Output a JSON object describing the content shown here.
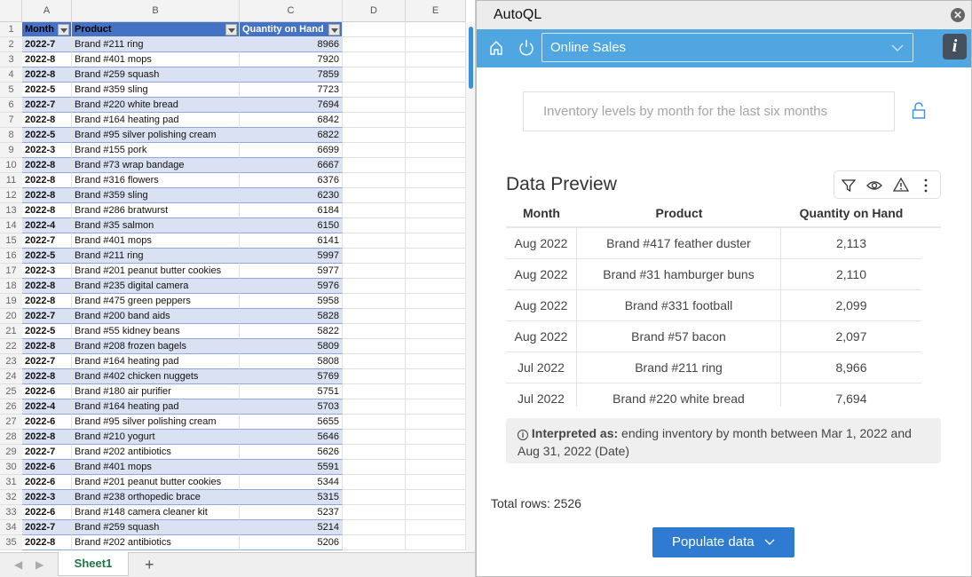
{
  "spreadsheet": {
    "column_letters": [
      "A",
      "B",
      "C",
      "D",
      "E"
    ],
    "headers": [
      "Month",
      "Product",
      "Quantity on Hand"
    ],
    "rows": [
      [
        "2022-7",
        "Brand #211 ring",
        "8966"
      ],
      [
        "2022-8",
        "Brand #401 mops",
        "7920"
      ],
      [
        "2022-8",
        "Brand #259 squash",
        "7859"
      ],
      [
        "2022-5",
        "Brand #359 sling",
        "7723"
      ],
      [
        "2022-7",
        "Brand #220 white bread",
        "7694"
      ],
      [
        "2022-8",
        "Brand #164 heating pad",
        "6842"
      ],
      [
        "2022-5",
        "Brand #95 silver polishing cream",
        "6822"
      ],
      [
        "2022-3",
        "Brand #155 pork",
        "6699"
      ],
      [
        "2022-8",
        "Brand #73 wrap bandage",
        "6667"
      ],
      [
        "2022-8",
        "Brand #316 flowers",
        "6376"
      ],
      [
        "2022-8",
        "Brand #359 sling",
        "6230"
      ],
      [
        "2022-8",
        "Brand #286 bratwurst",
        "6184"
      ],
      [
        "2022-4",
        "Brand #35 salmon",
        "6150"
      ],
      [
        "2022-7",
        "Brand #401 mops",
        "6141"
      ],
      [
        "2022-5",
        "Brand #211 ring",
        "5997"
      ],
      [
        "2022-3",
        "Brand #201 peanut butter cookies",
        "5977"
      ],
      [
        "2022-8",
        "Brand #235 digital camera",
        "5976"
      ],
      [
        "2022-8",
        "Brand #475 green peppers",
        "5958"
      ],
      [
        "2022-7",
        "Brand #200 band aids",
        "5828"
      ],
      [
        "2022-5",
        "Brand #55 kidney beans",
        "5822"
      ],
      [
        "2022-8",
        "Brand #208 frozen bagels",
        "5809"
      ],
      [
        "2022-7",
        "Brand #164 heating pad",
        "5808"
      ],
      [
        "2022-8",
        "Brand #402 chicken nuggets",
        "5769"
      ],
      [
        "2022-6",
        "Brand #180 air purifier",
        "5751"
      ],
      [
        "2022-4",
        "Brand #164 heating pad",
        "5703"
      ],
      [
        "2022-6",
        "Brand #95 silver polishing cream",
        "5655"
      ],
      [
        "2022-8",
        "Brand #210 yogurt",
        "5646"
      ],
      [
        "2022-7",
        "Brand #202 antibiotics",
        "5626"
      ],
      [
        "2022-6",
        "Brand #401 mops",
        "5591"
      ],
      [
        "2022-6",
        "Brand #201 peanut butter cookies",
        "5344"
      ],
      [
        "2022-3",
        "Brand #238 orthopedic brace",
        "5315"
      ],
      [
        "2022-6",
        "Brand #148 camera cleaner kit",
        "5237"
      ],
      [
        "2022-7",
        "Brand #259 squash",
        "5214"
      ],
      [
        "2022-8",
        "Brand #202 antibiotics",
        "5206"
      ]
    ],
    "sheet_tab": "Sheet1",
    "add_sheet": "+"
  },
  "panel": {
    "title": "AutoQL",
    "data_source": "Online Sales",
    "query_placeholder": "Inventory levels by month for the last six months",
    "preview_title": "Data Preview",
    "columns": [
      "Month",
      "Product",
      "Quantity on Hand"
    ],
    "rows": [
      [
        "Aug 2022",
        "Brand #417 feather duster",
        "2,113"
      ],
      [
        "Aug 2022",
        "Brand #31 hamburger buns",
        "2,110"
      ],
      [
        "Aug 2022",
        "Brand #331 football",
        "2,099"
      ],
      [
        "Aug 2022",
        "Brand #57 bacon",
        "2,097"
      ],
      [
        "Jul 2022",
        "Brand #211 ring",
        "8,966"
      ],
      [
        "Jul 2022",
        "Brand #220 white bread",
        "7,694"
      ]
    ],
    "interpreted_label": "Interpreted as:",
    "interpreted_text": " ending inventory by month between Mar 1, 2022 and Aug 31, 2022 (Date)",
    "total_rows": "Total rows: 2526",
    "populate_button": "Populate data",
    "colors": {
      "blue_bar": "#4fa6e0",
      "button": "#2f7bd1",
      "table_header": "#4472c4",
      "band": "#d9e1f2"
    }
  }
}
